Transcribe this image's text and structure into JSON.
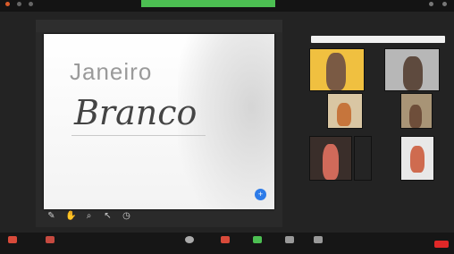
{
  "slide": {
    "title_line1": "Janeiro",
    "title_line2": "Branco"
  },
  "colors": {
    "accent_green": "#4cbf52",
    "end_red": "#e02828",
    "slide_button_blue": "#2d7be8"
  },
  "icons": {
    "annotation_tools": [
      "pen-icon",
      "hand-icon",
      "zoom-icon",
      "pointer-icon",
      "clock-icon"
    ],
    "bottom_toolbar": [
      "mic-icon",
      "camera-icon",
      "security-icon",
      "participants-icon",
      "chat-icon",
      "share-screen-icon",
      "record-icon",
      "reactions-icon",
      "end-icon"
    ]
  }
}
